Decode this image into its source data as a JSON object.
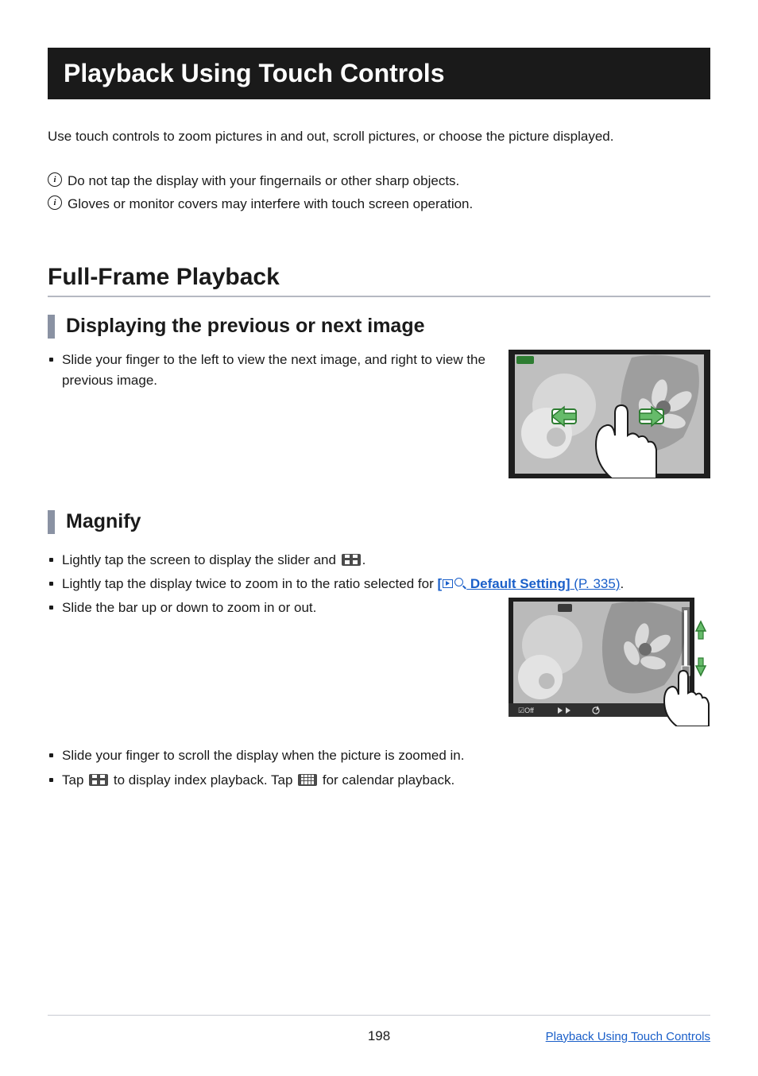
{
  "title": "Playback Using Touch Controls",
  "intro": "Use touch controls to zoom pictures in and out, scroll pictures, or choose the picture displayed.",
  "caution1": "Do not tap the display with your fingernails or other sharp objects.",
  "caution2": "Gloves or monitor covers may interfere with touch screen operation.",
  "section1": {
    "heading": "Full-Frame Playback",
    "sub1": {
      "heading": "Displaying the previous or next image",
      "bullet1": "Slide your finger to the left to view the next image, and right to view the previous image."
    },
    "sub2": {
      "heading": "Magnify",
      "bullet1_a": "Lightly tap the screen to display the slider and ",
      "bullet1_c": ".",
      "bullet2_a": "Lightly tap the display twice to zoom in to the ratio selected for ",
      "bullet2_link_a": "[",
      "bullet2_link_b": " Default Setting]",
      "bullet2_link_c": " (P. 335)",
      "bullet2_d": ".",
      "bullet3": "Slide the bar up or down to zoom in or out.",
      "bullet4": "Slide your finger to scroll the display when the picture is zoomed in.",
      "bullet5_a": "Tap ",
      "bullet5_b": " to display index playback. Tap ",
      "bullet5_c": " for calendar playback."
    }
  },
  "footer": {
    "page": "198",
    "link": "Playback Using Touch Controls"
  }
}
